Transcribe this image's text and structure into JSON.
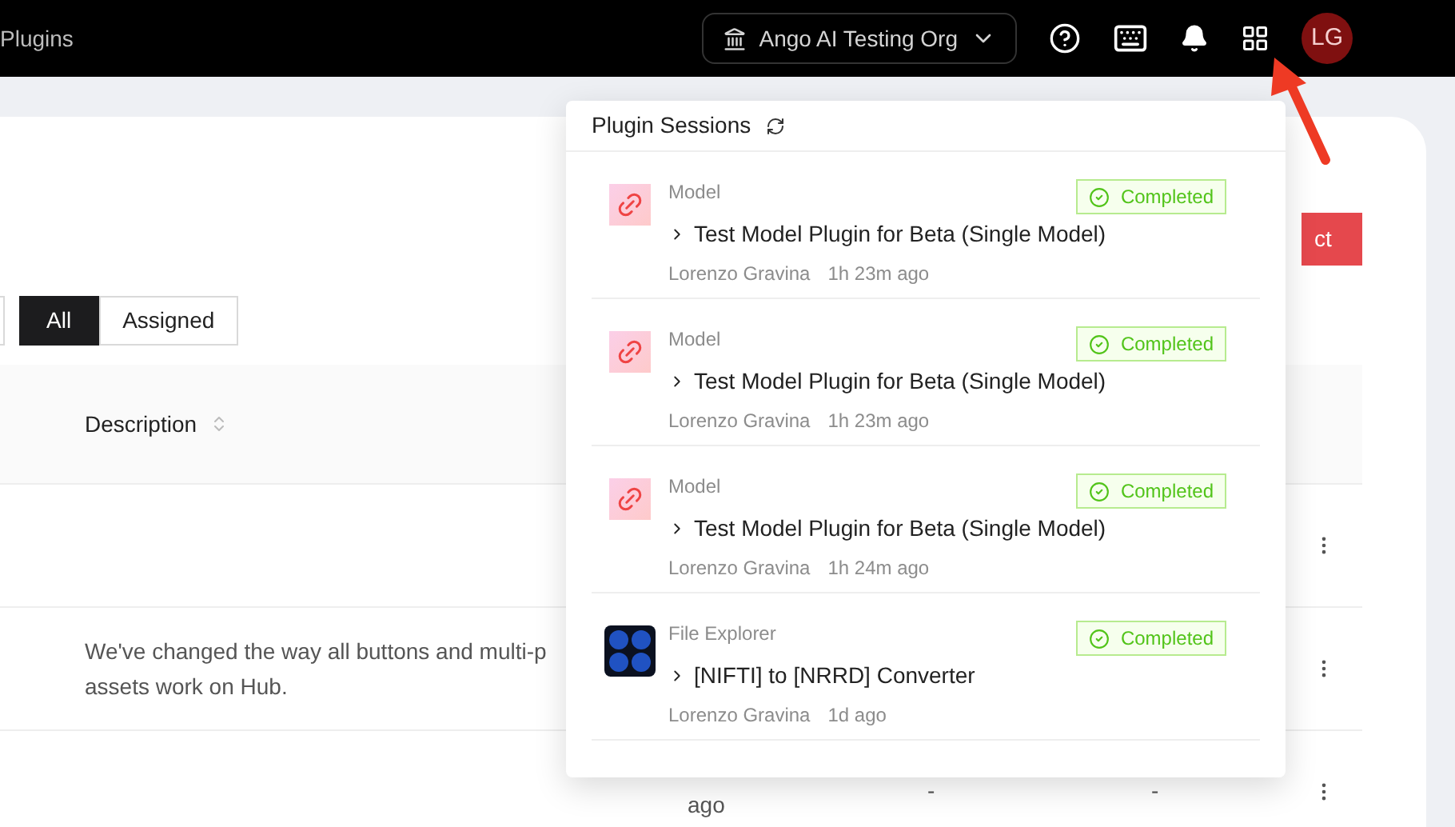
{
  "topbar": {
    "title": "Plugins",
    "org_selector": "Ango AI Testing Org",
    "avatar": "LG"
  },
  "page": {
    "action_button": "ct",
    "filter_tabs": [
      {
        "label": "All",
        "selected": true
      },
      {
        "label": "Assigned",
        "selected": false
      }
    ],
    "table": {
      "columns": [
        "Description"
      ],
      "rows": [
        {},
        {
          "description_lines": [
            "We've changed the way all buttons and multi-p",
            "assets work on Hub."
          ]
        },
        {
          "time": "ago",
          "column_4": "-",
          "column_5": "-"
        }
      ]
    }
  },
  "plugin_sessions": {
    "title": "Plugin Sessions",
    "sessions": [
      {
        "kind": "model",
        "type": "Model",
        "name": "Test Model Plugin for Beta (Single Model)",
        "user": "Lorenzo Gravina",
        "time": "1h 23m ago",
        "status": "Completed"
      },
      {
        "kind": "model",
        "type": "Model",
        "name": "Test Model Plugin for Beta (Single Model)",
        "user": "Lorenzo Gravina",
        "time": "1h 23m ago",
        "status": "Completed"
      },
      {
        "kind": "model",
        "type": "Model",
        "name": "Test Model Plugin for Beta (Single Model)",
        "user": "Lorenzo Gravina",
        "time": "1h 24m ago",
        "status": "Completed"
      },
      {
        "kind": "file-explorer",
        "type": "File Explorer",
        "name": "[NIFTI] to [NRRD] Converter",
        "user": "Lorenzo Gravina",
        "time": "1d ago",
        "status": "Completed"
      }
    ]
  }
}
